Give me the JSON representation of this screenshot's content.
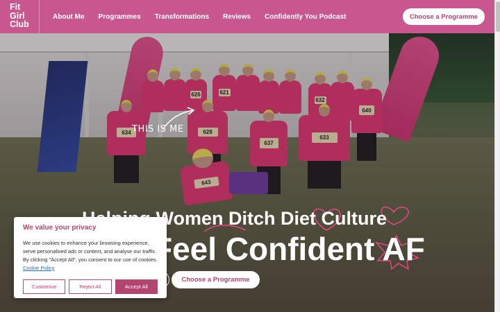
{
  "header": {
    "logo_lines": [
      "Fit",
      "Girl",
      "Club"
    ],
    "nav": [
      "About Me",
      "Programmes",
      "Transformations",
      "Reviews",
      "Confidently You Podcast"
    ],
    "cta": "Choose a Programme"
  },
  "hero": {
    "annotation": "THIS IS ME",
    "headline_line1": "Helping Women Ditch Diet Culture",
    "headline_line2": "Feel Confident AF",
    "cta": "Choose a Programme",
    "bibs": [
      "634",
      "628",
      "637",
      "633",
      "643",
      "626",
      "632",
      "640",
      "621"
    ]
  },
  "cookie_banner": {
    "title": "We value your privacy",
    "body": "We use cookies to enhance your browsing experience, serve personalised ads or content, and analyse our traffic. By clicking \"Accept All\", you consent to our use of cookies.",
    "policy_link": "Cookie Policy",
    "buttons": {
      "customise": "Customise",
      "reject": "Reject All",
      "accept": "Accept All"
    }
  },
  "colors": {
    "brand": "#c9578f",
    "brand_dark": "#b2456f"
  }
}
